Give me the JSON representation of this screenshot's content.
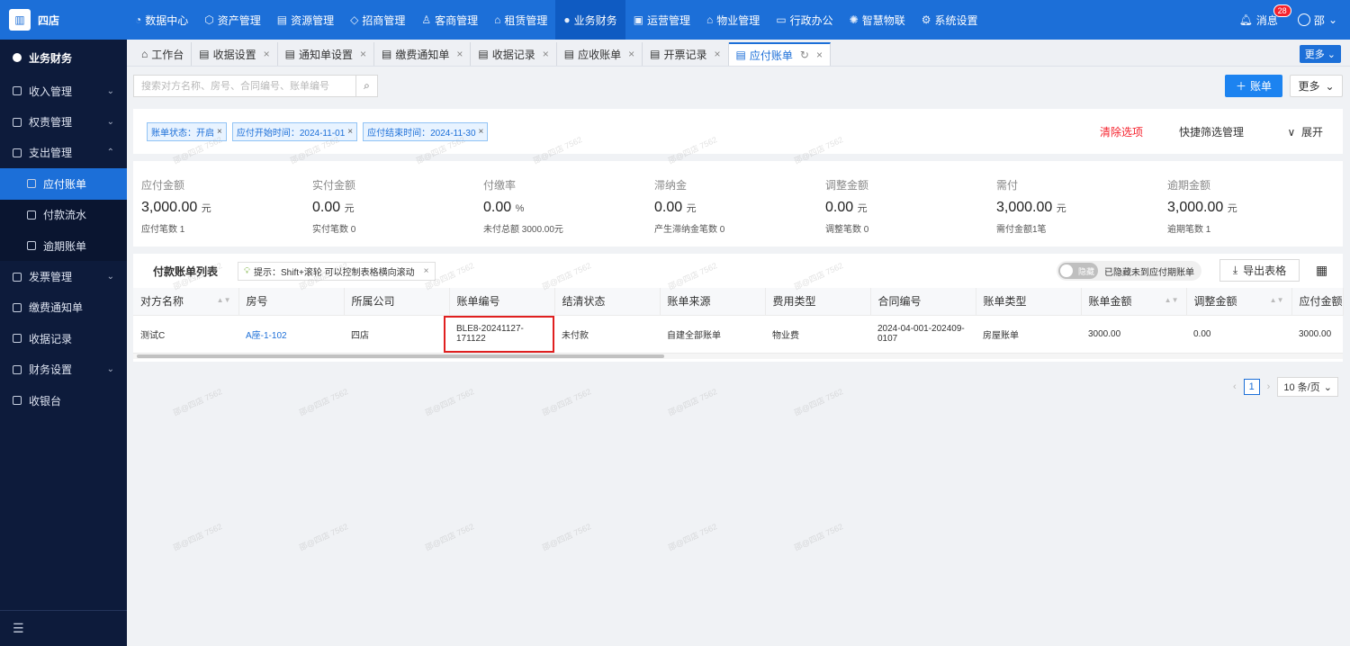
{
  "brand": {
    "name": "四店"
  },
  "topnav": [
    {
      "label": "数据中心",
      "icon": "dashboard-icon",
      "active": false
    },
    {
      "label": "资产管理",
      "icon": "cube-icon",
      "active": false
    },
    {
      "label": "资源管理",
      "icon": "building-icon",
      "active": false
    },
    {
      "label": "招商管理",
      "icon": "tag-icon",
      "active": false
    },
    {
      "label": "客商管理",
      "icon": "users-icon",
      "active": false
    },
    {
      "label": "租赁管理",
      "icon": "home-icon",
      "active": false
    },
    {
      "label": "业务财务",
      "icon": "coin-icon",
      "active": true
    },
    {
      "label": "运营管理",
      "icon": "document-icon",
      "active": false
    },
    {
      "label": "物业管理",
      "icon": "house-icon",
      "active": false
    },
    {
      "label": "行政办公",
      "icon": "office-icon",
      "active": false
    },
    {
      "label": "智慧物联",
      "icon": "iot-icon",
      "active": false
    },
    {
      "label": "系统设置",
      "icon": "gear-icon",
      "active": false
    }
  ],
  "header": {
    "messages": "消息",
    "badge": "28",
    "user": "邵"
  },
  "sidebar": {
    "title": "业务财务",
    "items": [
      {
        "label": "收入管理",
        "expanded": false
      },
      {
        "label": "权责管理",
        "expanded": false
      },
      {
        "label": "支出管理",
        "expanded": true
      },
      {
        "label": "应付账单",
        "sub": true,
        "active": true
      },
      {
        "label": "付款流水",
        "sub": true
      },
      {
        "label": "逾期账单",
        "sub": true
      },
      {
        "label": "发票管理",
        "expanded": false
      },
      {
        "label": "缴费通知单"
      },
      {
        "label": "收据记录"
      },
      {
        "label": "财务设置",
        "expanded": false
      },
      {
        "label": "收银台"
      }
    ]
  },
  "tabs": [
    {
      "label": "工作台"
    },
    {
      "label": "收据设置"
    },
    {
      "label": "通知单设置"
    },
    {
      "label": "缴费通知单"
    },
    {
      "label": "收据记录"
    },
    {
      "label": "应收账单"
    },
    {
      "label": "开票记录"
    },
    {
      "label": "应付账单",
      "active": true
    }
  ],
  "tabs_more": "更多",
  "toolbar": {
    "search_placeholder": "搜索对方名称、房号、合同编号、账单编号",
    "add_label": "账单",
    "more_label": "更多"
  },
  "filters": {
    "chips": [
      "账单状态：开启",
      "应付开始时间：2024-11-01",
      "应付结束时间：2024-11-30"
    ],
    "clear": "清除选项",
    "quick": "快捷筛选管理",
    "expand": "展开"
  },
  "stats": [
    {
      "label": "应付金额",
      "value": "3,000.00",
      "unit": "元",
      "sub": "应付笔数 1"
    },
    {
      "label": "实付金额",
      "value": "0.00",
      "unit": "元",
      "sub": "实付笔数 0"
    },
    {
      "label": "付缴率",
      "value": "0.00",
      "unit": "%",
      "sub": "未付总额 3000.00元"
    },
    {
      "label": "滞纳金",
      "value": "0.00",
      "unit": "元",
      "sub": "产生滞纳金笔数 0"
    },
    {
      "label": "调整金额",
      "value": "0.00",
      "unit": "元",
      "sub": "调整笔数 0"
    },
    {
      "label": "需付",
      "value": "3,000.00",
      "unit": "元",
      "sub": "需付金额1笔"
    },
    {
      "label": "逾期金额",
      "value": "3,000.00",
      "unit": "元",
      "sub": "逾期笔数 1"
    }
  ],
  "table": {
    "title": "付款账单列表",
    "hint": "提示：Shift+滚轮 可以控制表格横向滚动",
    "toggle_on": "隐藏",
    "toggle_label": "已隐藏未到应付期账单",
    "export": "导出表格",
    "columns": [
      "对方名称",
      "房号",
      "所属公司",
      "账单编号",
      "结清状态",
      "账单来源",
      "费用类型",
      "合同编号",
      "账单类型",
      "账单金额",
      "调整金额",
      "应付金额"
    ],
    "rows": [
      [
        "测试C",
        "A座-1-102",
        "四店",
        "BLE8-20241127-171122",
        "未付款",
        "自建全部账单",
        "物业费",
        "2024-04-001-202409-0107",
        "房屋账单",
        "3000.00",
        "0.00",
        "3000.00"
      ]
    ]
  },
  "pagination": {
    "page": "1",
    "size": "10 条/页"
  },
  "watermark": "邵@四店 7562"
}
